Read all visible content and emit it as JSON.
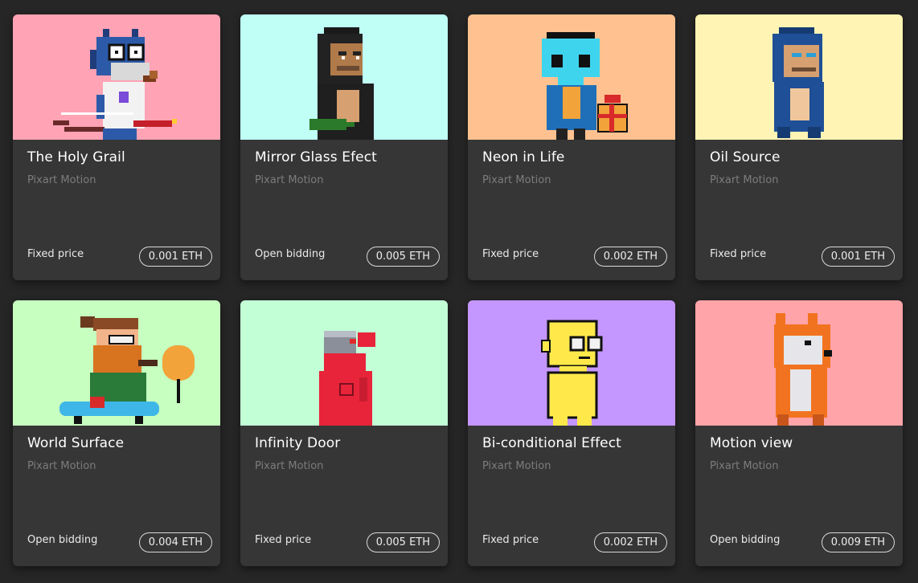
{
  "cards": [
    {
      "title": "The Holy Grail",
      "creator": "Pixart Motion",
      "price_type": "Fixed price",
      "price": "0.001 ETH",
      "bg": "#ffa3b5",
      "icon": "cat-wizard-icon"
    },
    {
      "title": "Mirror Glass Efect",
      "creator": "Pixart Motion",
      "price_type": "Open bidding",
      "price": "0.005 ETH",
      "bg": "#bffff6",
      "icon": "ape-icon"
    },
    {
      "title": "Neon in Life",
      "creator": "Pixart Motion",
      "price_type": "Fixed price",
      "price": "0.002 ETH",
      "bg": "#ffc18f",
      "icon": "alien-icon"
    },
    {
      "title": "Oil Source",
      "creator": "Pixart Motion",
      "price_type": "Fixed price",
      "price": "0.001 ETH",
      "bg": "#fff4b3",
      "icon": "blue-ape-icon"
    },
    {
      "title": "World Surface",
      "creator": "Pixart Motion",
      "price_type": "Open bidding",
      "price": "0.004 ETH",
      "bg": "#c6ffbf",
      "icon": "bearded-man-icon"
    },
    {
      "title": "Infinity Door",
      "creator": "Pixart Motion",
      "price_type": "Fixed price",
      "price": "0.005 ETH",
      "bg": "#c3ffd6",
      "icon": "robot-bear-icon"
    },
    {
      "title": "Bi-conditional Effect",
      "creator": "Pixart Motion",
      "price_type": "Fixed price",
      "price": "0.002 ETH",
      "bg": "#c496ff",
      "icon": "yellow-figure-icon"
    },
    {
      "title": "Motion view",
      "creator": "Pixart Motion",
      "price_type": "Open bidding",
      "price": "0.009 ETH",
      "bg": "#ffa4a9",
      "icon": "fox-icon"
    }
  ]
}
